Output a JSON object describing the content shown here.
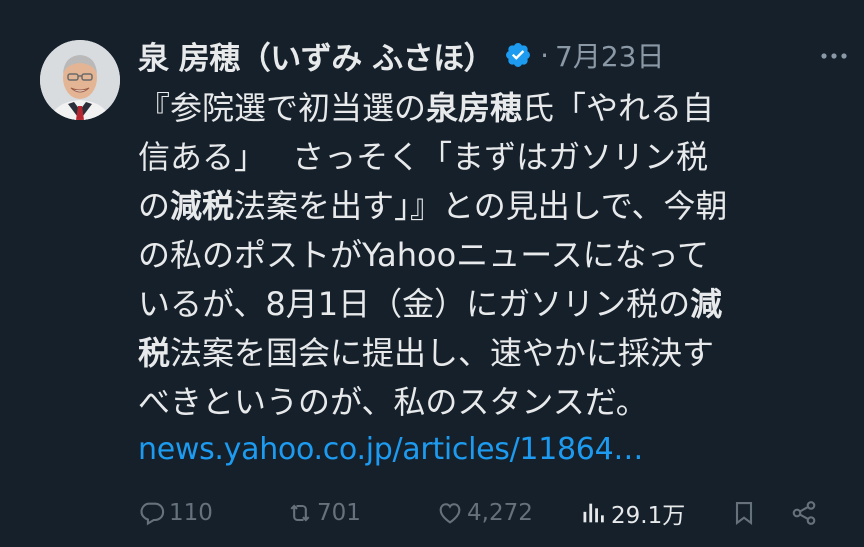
{
  "author": {
    "name": "泉 房穂（いずみ ふさほ）",
    "verified": true,
    "avatar_icon": "person-portrait"
  },
  "meta": {
    "separator": "·",
    "date": "7月23日"
  },
  "post": {
    "lines": [
      [
        {
          "t": "『参院選で初当選の"
        },
        {
          "t": "泉房穂",
          "b": true
        },
        {
          "t": "氏「やれる自"
        }
      ],
      [
        {
          "t": "信ある」　 さっそく「まずはガソリン税"
        }
      ],
      [
        {
          "t": "の"
        },
        {
          "t": "減税",
          "b": true
        },
        {
          "t": "法案を出す」』との見出しで、今朝"
        }
      ],
      [
        {
          "t": "の私のポストがYahooニュースになって"
        }
      ],
      [
        {
          "t": "いるが、8月1日（金）にガソリン税の"
        },
        {
          "t": "減",
          "b": true
        }
      ],
      [
        {
          "t": "税",
          "b": true
        },
        {
          "t": "法案を国会に提出し、速やかに採決す"
        }
      ],
      [
        {
          "t": "べきというのが、私のスタンスだ。"
        }
      ]
    ],
    "link": "news.yahoo.co.jp/articles/11864…"
  },
  "actions": {
    "replies": "110",
    "reposts": "701",
    "likes": "4,272",
    "views": "29.1万"
  },
  "colors": {
    "background": "#15202b",
    "text": "#e7e9ea",
    "muted": "#66717c",
    "accent": "#1d9bf0"
  }
}
